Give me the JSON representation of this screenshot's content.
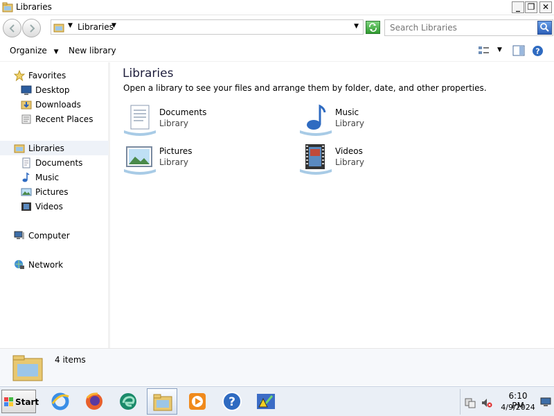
{
  "window": {
    "title": "Libraries",
    "minimize_label": "_",
    "maximize_label": "❐",
    "close_label": "✕"
  },
  "address_bar": {
    "location": "Libraries",
    "search_placeholder": "Search Libraries"
  },
  "toolbar": {
    "organize_label": "Organize",
    "new_library_label": "New library"
  },
  "nav_pane": {
    "favorites": {
      "label": "Favorites",
      "items": [
        "Desktop",
        "Downloads",
        "Recent Places"
      ]
    },
    "libraries": {
      "label": "Libraries",
      "items": [
        "Documents",
        "Music",
        "Pictures",
        "Videos"
      ]
    },
    "computer": "Computer",
    "network": "Network"
  },
  "content": {
    "title": "Libraries",
    "subtitle": "Open a library to see your files and arrange them by folder, date, and other properties.",
    "libraries": [
      {
        "name": "Documents",
        "type": "Library",
        "icon": "documents-library-icon"
      },
      {
        "name": "Music",
        "type": "Library",
        "icon": "music-library-icon"
      },
      {
        "name": "Pictures",
        "type": "Library",
        "icon": "pictures-library-icon"
      },
      {
        "name": "Videos",
        "type": "Library",
        "icon": "videos-library-icon"
      }
    ]
  },
  "details_pane": {
    "item_count": "4 items"
  },
  "taskbar": {
    "start_label": "Start",
    "apps": [
      "internet-explorer-icon",
      "firefox-icon",
      "edge-icon",
      "file-explorer-icon",
      "media-player-icon",
      "help-icon",
      "action-center-icon"
    ],
    "clock_time": "6:10 PM",
    "clock_date": "4/9/2024"
  },
  "colors": {
    "accent": "#2c5fb8",
    "selection": "#eef2f8",
    "taskbar": "#eaeff6"
  }
}
